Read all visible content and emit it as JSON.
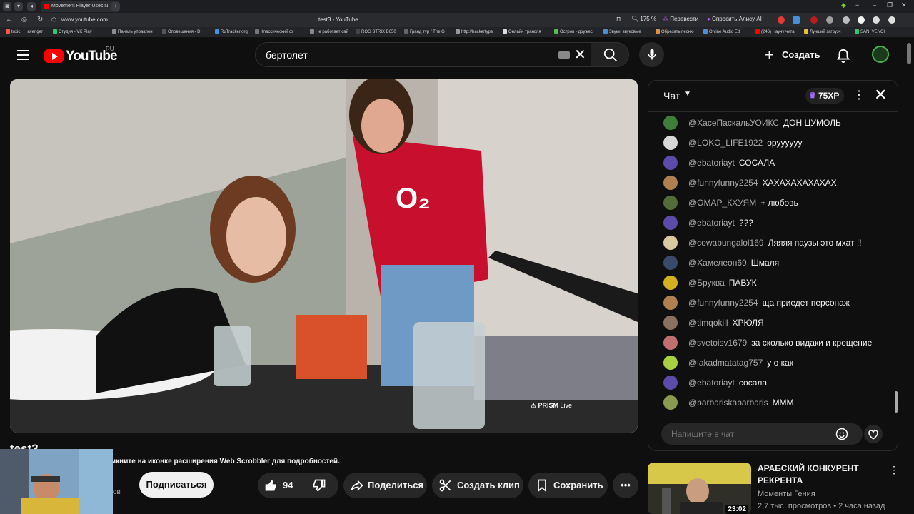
{
  "browser": {
    "tab_title": "Movement Player Uses N",
    "url": "www.youtube.com",
    "page_title": "test3 - YouTube",
    "zoom": "175 %",
    "translate_label": "Перевести",
    "alice_label": "Спросить Алису AI",
    "bookmarks": [
      "toxic___avenger",
      "Студия - VK Play",
      "Панель управлен",
      "Оповещения - D",
      "RuTracker.org",
      "Классический ф",
      "Не работает сай",
      "ROG STRIX B650",
      "Гранд тур / The G",
      "http://hackertype",
      "Онлайн трансля",
      "Остров - дружес",
      "Звуки, звуковые",
      "Обрезать песню",
      "Online Audio Edi",
      "(246) Научу чита",
      "Лучший загрузч",
      "SAN_VENCI"
    ]
  },
  "header": {
    "logo_text": "YouTube",
    "country": "RU",
    "search_value": "бертолет",
    "create_label": "Создать"
  },
  "video": {
    "overlay_watermark": "PRISM",
    "overlay_live": "Live",
    "title": "test3",
    "scrobbler_notice": "икните на иконке расширения Web Scrobbler для подробностей.",
    "subs_suffix": "ов",
    "subscribe_label": "Подписаться",
    "like_count": "94",
    "share_label": "Поделиться",
    "clip_label": "Создать клип",
    "save_label": "Сохранить"
  },
  "chat": {
    "title": "Чат",
    "xp": "75XP",
    "input_placeholder": "Напишите в чат",
    "messages": [
      {
        "author": "@ХасеПаскальУОИКС",
        "text": "ДОН ЦУМОЛЬ",
        "color": "#3f7d3a"
      },
      {
        "author": "@LOKO_LIFE1922",
        "text": "оруууууу",
        "color": "#d8d8d8"
      },
      {
        "author": "@ebatoriayt",
        "text": "СОСАЛА",
        "color": "#5c4ba8"
      },
      {
        "author": "@funnyfunny2254",
        "text": "ХАХАХАХАХАХАХ",
        "color": "#b08050"
      },
      {
        "author": "@ОМАР_КХУЯМ",
        "text": "+ любовь",
        "color": "#546b3a"
      },
      {
        "author": "@ebatoriayt",
        "text": "???",
        "color": "#5c4ba8"
      },
      {
        "author": "@cowabungalol169",
        "text": "Ляяяя паузы это мхат !!",
        "color": "#d9c9a0"
      },
      {
        "author": "@Хамелеон69",
        "text": "Шмаля",
        "color": "#3a4a6a"
      },
      {
        "author": "@Бруква",
        "text": "ПАВУК",
        "color": "#d4b020"
      },
      {
        "author": "@funnyfunny2254",
        "text": "ща приедет персонаж",
        "color": "#b08050"
      },
      {
        "author": "@timqokill",
        "text": "ХРЮЛЯ",
        "color": "#8a7060"
      },
      {
        "author": "@svetoisv1679",
        "text": "за сколько видаки и крещение",
        "color": "#c07070"
      },
      {
        "author": "@lakadmatatag757",
        "text": "у о как",
        "color": "#a8d040"
      },
      {
        "author": "@ebatoriayt",
        "text": "сосала",
        "color": "#5c4ba8"
      },
      {
        "author": "@barbariskabarbaris",
        "text": "МММ",
        "color": "#8a9a50"
      }
    ]
  },
  "recommendation": {
    "title": "АРАБСКИЙ КОНКУРЕНТ РЕКРЕНТА",
    "channel": "Моменты Гения",
    "meta": "2,7 тыс. просмотров • 2 часа назад",
    "duration": "23:02"
  },
  "colors": {
    "background": "#0f0f0f",
    "accent_red": "#ff0000",
    "pill_bg": "#272727"
  }
}
